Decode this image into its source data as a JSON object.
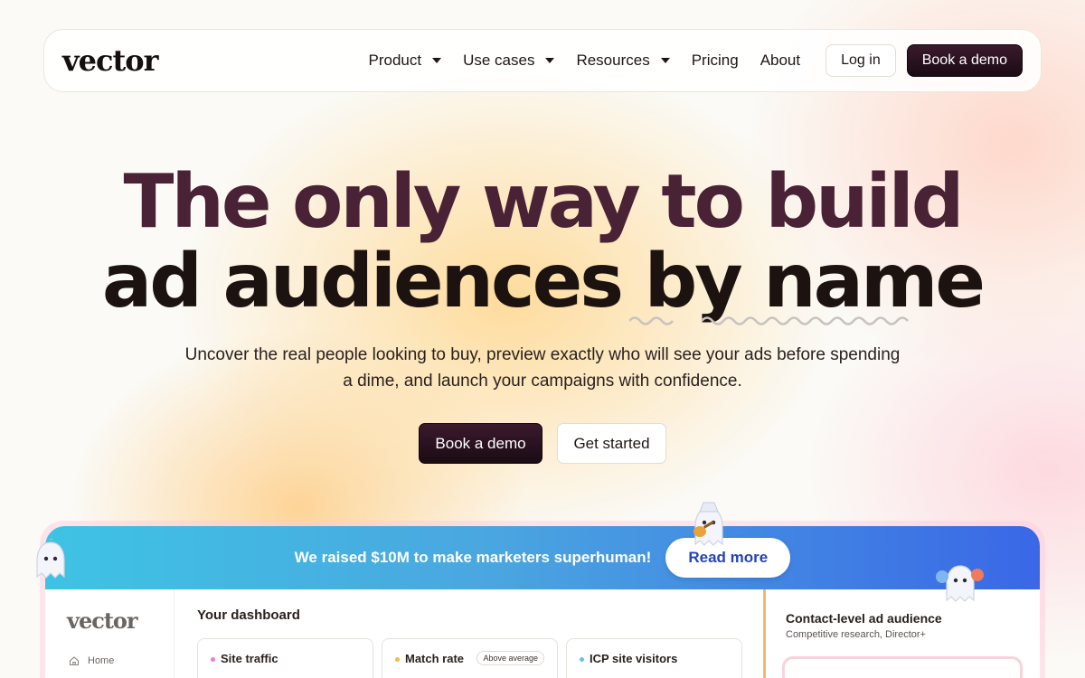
{
  "nav": {
    "logo": "vector",
    "items": [
      {
        "label": "Product",
        "has_dropdown": true
      },
      {
        "label": "Use cases",
        "has_dropdown": true
      },
      {
        "label": "Resources",
        "has_dropdown": true
      },
      {
        "label": "Pricing",
        "has_dropdown": false
      },
      {
        "label": "About",
        "has_dropdown": false
      }
    ],
    "login_label": "Log in",
    "demo_label": "Book a demo"
  },
  "hero": {
    "title_line1": "The only way to build",
    "title_line2": "ad audiences by name",
    "subtitle": "Uncover the real people looking to buy, preview exactly who will see your ads before spending a dime, and launch your campaigns with confidence.",
    "cta_primary": "Book a demo",
    "cta_secondary": "Get started"
  },
  "banner": {
    "text": "We raised $10M to make marketers superhuman!",
    "button": "Read more"
  },
  "dashboard": {
    "logo": "vector",
    "sidebar": [
      {
        "label": "Home",
        "icon": "home-icon"
      }
    ],
    "title": "Your dashboard",
    "cards": [
      {
        "label": "Site traffic",
        "dot_color": "#f27ad0",
        "badge": ""
      },
      {
        "label": "Match rate",
        "dot_color": "#f5b944",
        "badge": "Above average"
      },
      {
        "label": "ICP site visitors",
        "dot_color": "#5cc6f0",
        "badge": ""
      }
    ],
    "right_pane": {
      "title": "Contact-level ad audience",
      "subtitle": "Competitive research, Director+"
    }
  },
  "colors": {
    "accent_dark": "#2a0f1e",
    "title_plum": "#4a2235",
    "banner_start": "#3ec3e4",
    "banner_end": "#3a67e6",
    "read_more_text": "#2443b8"
  }
}
